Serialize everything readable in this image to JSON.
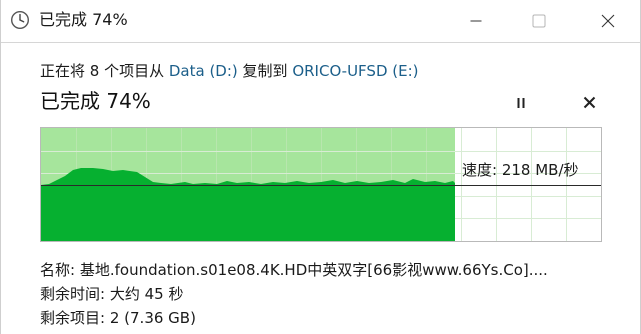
{
  "window": {
    "title": "已完成 74%",
    "icon": "clock-icon",
    "controls": [
      "minimize-icon",
      "maximize-icon",
      "close-icon"
    ]
  },
  "copy": {
    "prefix": "正在将 8 个项目从 ",
    "source": "Data (D:)",
    "middle": " 复制到 ",
    "destination": "ORICO-UFSD (E:)"
  },
  "progress": {
    "heading": "已完成 74%",
    "percent": 74,
    "pause_icon": "pause-icon",
    "cancel_icon": "cancel-icon"
  },
  "graph": {
    "speed_label": "速度: 218 MB/秒",
    "progress_fraction": 0.74,
    "colors": {
      "fill_done": "#a6e59c",
      "fill_speed": "#06b030",
      "grid": "#c8e8c2",
      "grid_empty": "#d8ecd4",
      "speed_line": "#2a2a2a"
    }
  },
  "details": {
    "name_label": "名称:",
    "name_value": "基地.foundation.s01e08.4K.HD中英双字[66影视www.66Ys.Co]....",
    "time_label": "剩余时间:",
    "time_value": "大约 45 秒",
    "items_label": "剩余项目:",
    "items_value": "2 (7.36 GB)"
  }
}
